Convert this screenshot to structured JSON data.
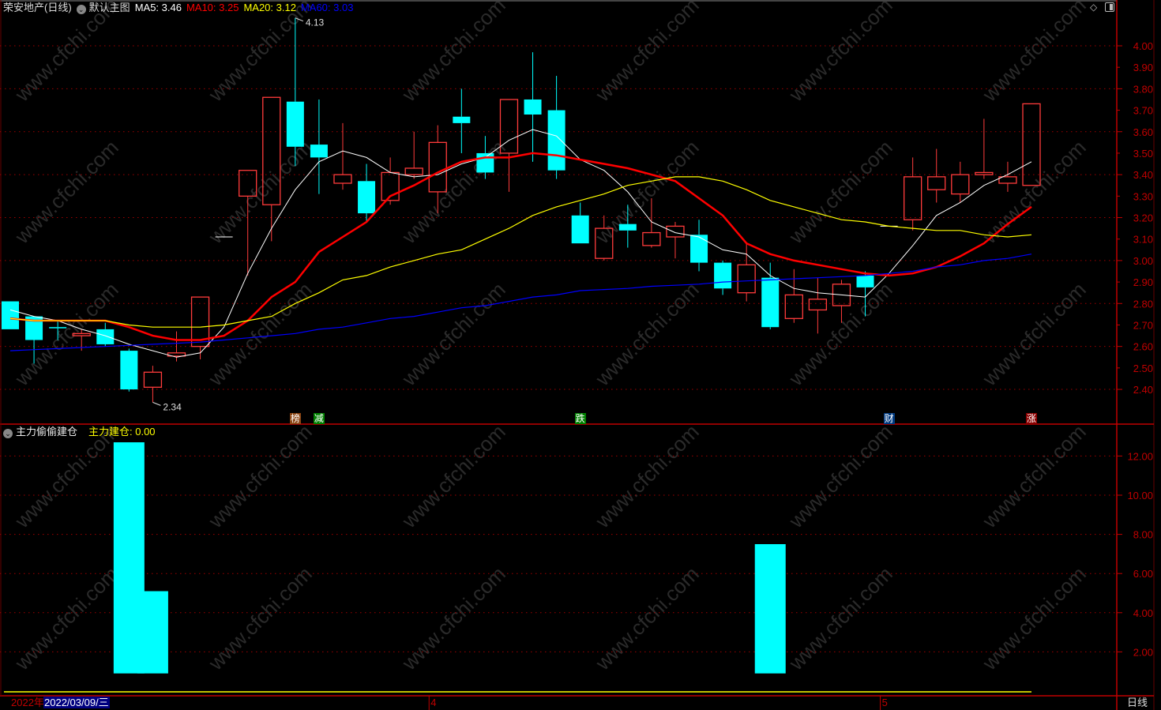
{
  "header": {
    "stock": "荣安地产(日线)",
    "template": "默认主图",
    "ma5": "MA5: 3.46",
    "ma10": "MA10: 3.25",
    "ma20": "MA20: 3.12",
    "ma60": "MA60: 3.03"
  },
  "indicator_header": {
    "name": "主力偷偷建仓",
    "value": "主力建仓: 0.00"
  },
  "date_axis": {
    "year": "2022年",
    "cursor_date": "2022/03/09/三",
    "months": [
      {
        "label": "4",
        "index": 18
      },
      {
        "label": "5",
        "index": 37
      }
    ],
    "period": "日线"
  },
  "markers": [
    {
      "label": "榜",
      "index": 12,
      "color": "#8b4513"
    },
    {
      "label": "减",
      "index": 13,
      "color": "#008000"
    },
    {
      "label": "跌",
      "index": 24,
      "color": "#008000"
    },
    {
      "label": "财",
      "index": 37,
      "color": "#003a80"
    },
    {
      "label": "涨",
      "index": 43,
      "color": "#8b0000"
    }
  ],
  "colors": {
    "up": "#ff3b3b",
    "down": "#00ffff",
    "ma5": "#ffffff",
    "ma10": "#ff0000",
    "ma20": "#ffff00",
    "ma60": "#0000ff",
    "axis": "#c00000",
    "grid": "#a00000"
  },
  "icons": [
    "collapse-circle-icon",
    "diamond-icon",
    "panel-toggle-icon"
  ],
  "chart_data": [
    {
      "type": "candlestick",
      "title": "",
      "ylim": [
        2.3,
        4.2
      ],
      "yticks": [
        "4.00",
        "3.90",
        "3.80",
        "3.70",
        "3.60",
        "3.50",
        "3.40",
        "3.30",
        "3.20",
        "3.10",
        "3.00",
        "2.90",
        "2.80",
        "2.70",
        "2.60",
        "2.50",
        "2.40"
      ],
      "grid": true,
      "candles_ohlc": [
        [
          2.81,
          2.81,
          2.68,
          2.68
        ],
        [
          2.74,
          2.74,
          2.52,
          2.63
        ],
        [
          2.69,
          2.72,
          2.63,
          2.685
        ],
        [
          2.65,
          2.68,
          2.58,
          2.66
        ],
        [
          2.68,
          2.71,
          2.6,
          2.61
        ],
        [
          2.58,
          2.59,
          2.39,
          2.4
        ],
        [
          2.41,
          2.51,
          2.34,
          2.48
        ],
        [
          2.555,
          2.67,
          2.53,
          2.57
        ],
        [
          2.6,
          2.83,
          2.54,
          2.83
        ],
        [
          3.11,
          3.11,
          3.11,
          3.11
        ],
        [
          3.3,
          3.42,
          2.93,
          3.42
        ],
        [
          3.26,
          3.76,
          3.09,
          3.76
        ],
        [
          3.74,
          4.13,
          3.44,
          3.53
        ],
        [
          3.54,
          3.75,
          3.31,
          3.48
        ],
        [
          3.36,
          3.64,
          3.33,
          3.4
        ],
        [
          3.37,
          3.45,
          3.18,
          3.22
        ],
        [
          3.28,
          3.48,
          3.26,
          3.41
        ],
        [
          3.4,
          3.6,
          3.38,
          3.43
        ],
        [
          3.32,
          3.63,
          3.22,
          3.55
        ],
        [
          3.67,
          3.8,
          3.5,
          3.64
        ],
        [
          3.5,
          3.58,
          3.38,
          3.41
        ],
        [
          3.5,
          3.75,
          3.32,
          3.75
        ],
        [
          3.75,
          3.97,
          3.46,
          3.68
        ],
        [
          3.7,
          3.86,
          3.38,
          3.42
        ],
        [
          3.21,
          3.27,
          3.08,
          3.08
        ],
        [
          3.01,
          3.21,
          3.0,
          3.15
        ],
        [
          3.17,
          3.26,
          3.06,
          3.14
        ],
        [
          3.07,
          3.29,
          3.06,
          3.13
        ],
        [
          3.11,
          3.18,
          3.01,
          3.16
        ],
        [
          3.12,
          3.19,
          2.95,
          2.99
        ],
        [
          2.99,
          3.0,
          2.84,
          2.87
        ],
        [
          2.85,
          3.08,
          2.81,
          2.98
        ],
        [
          2.92,
          2.99,
          2.68,
          2.69
        ],
        [
          2.73,
          2.96,
          2.71,
          2.84
        ],
        [
          2.77,
          2.92,
          2.66,
          2.82
        ],
        [
          2.79,
          2.91,
          2.71,
          2.89
        ],
        [
          2.93,
          2.95,
          2.74,
          2.875
        ],
        [
          3.16,
          3.16,
          3.16,
          3.16
        ],
        [
          3.19,
          3.48,
          3.14,
          3.39
        ],
        [
          3.33,
          3.52,
          3.27,
          3.39
        ],
        [
          3.31,
          3.46,
          3.27,
          3.4
        ],
        [
          3.4,
          3.66,
          3.38,
          3.41
        ],
        [
          3.36,
          3.46,
          3.32,
          3.39
        ],
        [
          3.35,
          3.73,
          3.35,
          3.73
        ]
      ],
      "series": [
        {
          "name": "MA5",
          "values": [
            2.77,
            2.74,
            2.72,
            2.68,
            2.65,
            2.61,
            2.58,
            2.55,
            2.57,
            2.69,
            2.94,
            3.15,
            3.33,
            3.46,
            3.51,
            3.48,
            3.41,
            3.39,
            3.4,
            3.45,
            3.48,
            3.56,
            3.61,
            3.58,
            3.47,
            3.42,
            3.32,
            3.18,
            3.13,
            3.11,
            3.05,
            3.03,
            2.93,
            2.87,
            2.85,
            2.84,
            2.83,
            2.94,
            3.07,
            3.21,
            3.27,
            3.35,
            3.4,
            3.46
          ]
        },
        {
          "name": "MA10",
          "values": [
            2.73,
            2.72,
            2.72,
            2.72,
            2.72,
            2.69,
            2.65,
            2.63,
            2.63,
            2.65,
            2.72,
            2.83,
            2.9,
            3.04,
            3.11,
            3.18,
            3.3,
            3.35,
            3.41,
            3.46,
            3.48,
            3.48,
            3.5,
            3.49,
            3.47,
            3.45,
            3.43,
            3.4,
            3.37,
            3.29,
            3.21,
            3.08,
            3.03,
            3.0,
            2.98,
            2.96,
            2.94,
            2.93,
            2.94,
            2.97,
            3.02,
            3.08,
            3.17,
            3.25
          ]
        },
        {
          "name": "MA20",
          "values": [
            2.73,
            2.72,
            2.72,
            2.72,
            2.72,
            2.7,
            2.69,
            2.69,
            2.69,
            2.7,
            2.72,
            2.74,
            2.8,
            2.85,
            2.91,
            2.93,
            2.97,
            3.0,
            3.03,
            3.05,
            3.1,
            3.15,
            3.21,
            3.25,
            3.28,
            3.31,
            3.35,
            3.37,
            3.39,
            3.39,
            3.37,
            3.33,
            3.28,
            3.25,
            3.22,
            3.19,
            3.18,
            3.16,
            3.15,
            3.14,
            3.14,
            3.12,
            3.11,
            3.12
          ]
        },
        {
          "name": "MA60",
          "values": [
            2.58,
            2.585,
            2.59,
            2.595,
            2.6,
            2.605,
            2.61,
            2.615,
            2.62,
            2.63,
            2.64,
            2.65,
            2.66,
            2.68,
            2.69,
            2.71,
            2.73,
            2.74,
            2.76,
            2.78,
            2.79,
            2.81,
            2.83,
            2.84,
            2.86,
            2.865,
            2.87,
            2.88,
            2.885,
            2.89,
            2.9,
            2.905,
            2.91,
            2.915,
            2.92,
            2.925,
            2.93,
            2.94,
            2.95,
            2.97,
            2.98,
            3.0,
            3.01,
            3.03
          ]
        }
      ],
      "annotations": [
        {
          "label": "4.13",
          "index": 12,
          "value": 4.13
        },
        {
          "label": "2.34",
          "index": 6,
          "value": 2.34
        }
      ]
    },
    {
      "type": "bar",
      "title": "主力偷偷建仓",
      "ylim": [
        0,
        13.5
      ],
      "yticks": [
        "12.00",
        "10.00",
        "8.00",
        "6.00",
        "4.00",
        "2.00"
      ],
      "grid": true,
      "bar_base": 0.9,
      "bars": [
        {
          "index": 5,
          "value": 12.7
        },
        {
          "index": 6,
          "value": 5.1
        },
        {
          "index": 32,
          "value": 7.5
        }
      ],
      "line_value": 0.0
    }
  ]
}
